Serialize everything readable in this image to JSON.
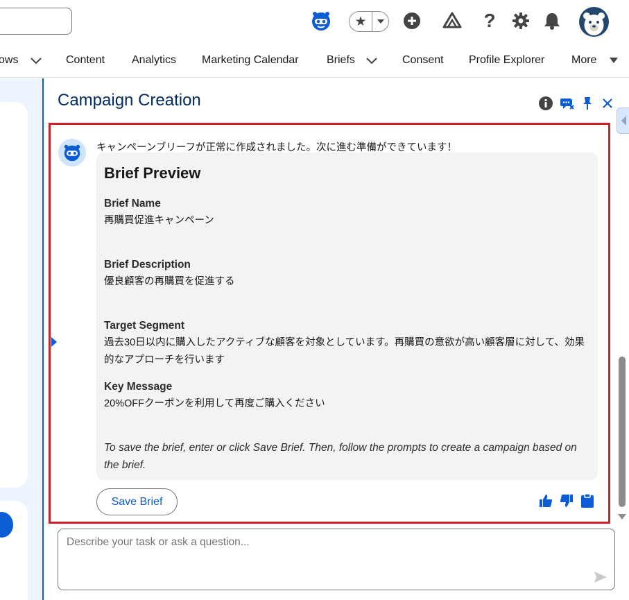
{
  "header": {
    "icons": [
      "einstein-bot-icon",
      "favorites-star-icon",
      "add-icon",
      "trailhead-icon",
      "help-icon",
      "setup-gear-icon",
      "notifications-bell-icon",
      "user-avatar"
    ]
  },
  "nav": {
    "items": [
      {
        "label": "ows",
        "has_menu": true
      },
      {
        "label": "Content",
        "has_menu": false
      },
      {
        "label": "Analytics",
        "has_menu": false
      },
      {
        "label": "Marketing Calendar",
        "has_menu": false
      },
      {
        "label": "Briefs",
        "has_menu": true
      },
      {
        "label": "Consent",
        "has_menu": false
      },
      {
        "label": "Profile Explorer",
        "has_menu": false
      },
      {
        "label": "More",
        "has_menu": true
      }
    ]
  },
  "panel": {
    "title": "Campaign Creation",
    "accent_color": "#0b5cd5",
    "highlight_color": "#d11f2a"
  },
  "message": {
    "text": "キャンペーンブリーフが正常に作成されました。次に進む準備ができています！"
  },
  "brief": {
    "title": "Brief Preview",
    "fields": [
      {
        "label": "Brief Name",
        "value": "再購買促進キャンペーン"
      },
      {
        "label": "Brief Description",
        "value": "優良顧客の再購買を促進する"
      },
      {
        "label": "Target Segment",
        "value": "過去30日以内に購入したアクティブな顧客を対象としています。再購買の意欲が高い顧客層に対して、効果的なアプローチを行います"
      },
      {
        "label": "Key Message",
        "value": "20%OFFクーポンを利用して再度ご購入ください"
      }
    ],
    "hint": "To save the brief, enter or click Save Brief. Then, follow the prompts to create a campaign based on the brief."
  },
  "actions": {
    "save_label": "Save Brief"
  },
  "composer": {
    "placeholder": "Describe your task or ask a question..."
  }
}
